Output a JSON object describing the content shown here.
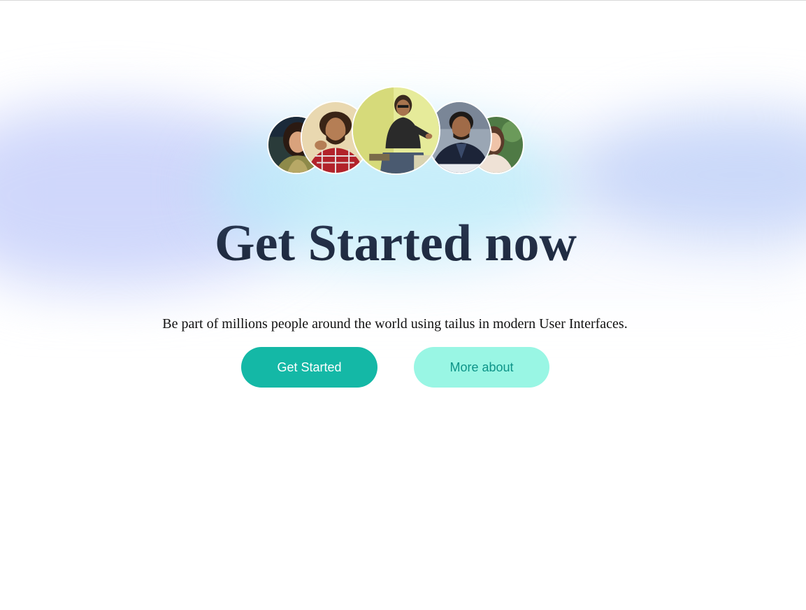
{
  "hero": {
    "title": "Get Started now",
    "subtitle": "Be part of millions people around the world using tailus in modern User Interfaces.",
    "primary_button": "Get Started",
    "secondary_button": "More about"
  },
  "avatars": [
    {
      "name": "avatar-1"
    },
    {
      "name": "avatar-2"
    },
    {
      "name": "avatar-3"
    },
    {
      "name": "avatar-4"
    },
    {
      "name": "avatar-5"
    }
  ],
  "colors": {
    "primary": "#14b8a6",
    "secondary_bg": "#99f6e4",
    "secondary_text": "#0d9488",
    "heading": "#1e293b"
  }
}
